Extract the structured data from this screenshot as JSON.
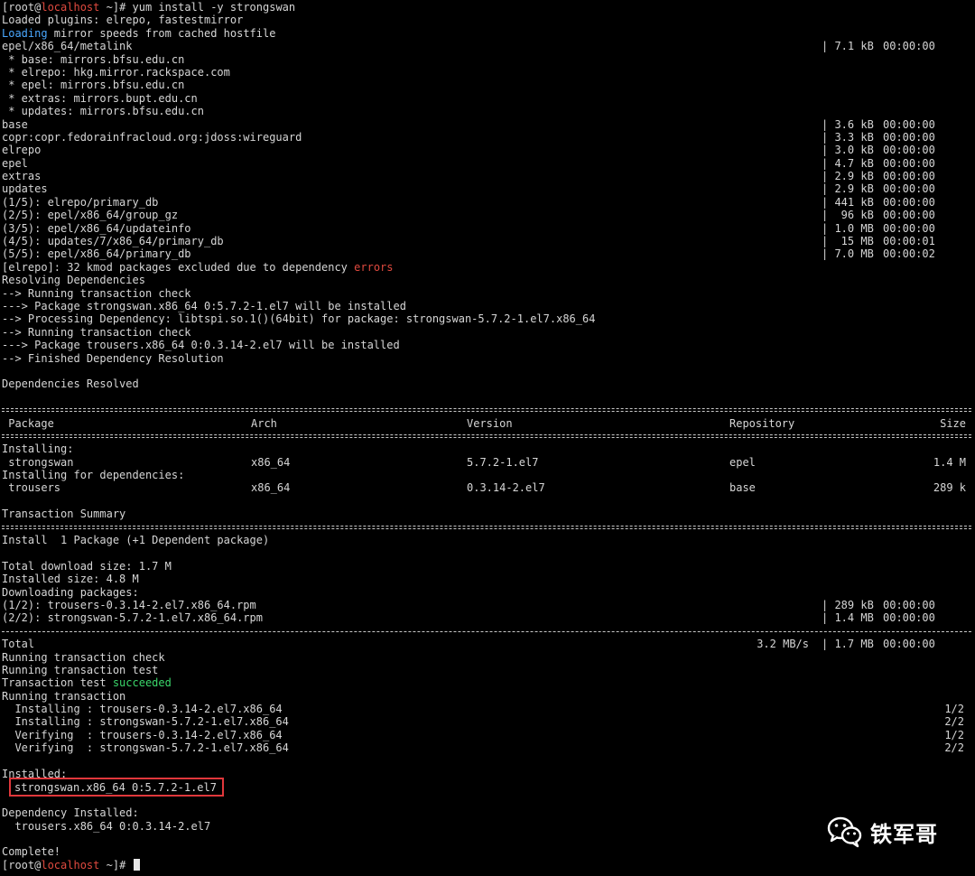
{
  "colors": {
    "background": "#000000",
    "text": "#d6d6d6",
    "hostname": "#e04a3f",
    "info": "#4aa8ff",
    "error": "#e04a3f",
    "success": "#3ad66a",
    "highlight_box": "#e0373b",
    "cursor": "#e8e8e8"
  },
  "prompt": {
    "open": "[root@",
    "host": "localhost",
    "close": " ~]# "
  },
  "command": "yum install -y strongswan",
  "lines": [
    {
      "segments": [
        {
          "text": "Loaded plugins: elrepo, fastestmirror"
        }
      ]
    },
    {
      "segments": [
        {
          "text": "Loading",
          "color": "info"
        },
        {
          "text": " mirror speeds from cached hostfile"
        }
      ]
    },
    {
      "segments": [
        {
          "text": "epel/x86_64/metalink"
        }
      ],
      "size": "| 7.1 kB",
      "meta": "00:00:00"
    },
    {
      "segments": [
        {
          "text": " * base: mirrors.bfsu.edu.cn"
        }
      ]
    },
    {
      "segments": [
        {
          "text": " * elrepo: hkg.mirror.rackspace.com"
        }
      ]
    },
    {
      "segments": [
        {
          "text": " * epel: mirrors.bfsu.edu.cn"
        }
      ]
    },
    {
      "segments": [
        {
          "text": " * extras: mirrors.bupt.edu.cn"
        }
      ]
    },
    {
      "segments": [
        {
          "text": " * updates: mirrors.bfsu.edu.cn"
        }
      ]
    },
    {
      "segments": [
        {
          "text": "base"
        }
      ],
      "size": "| 3.6 kB",
      "meta": "00:00:00"
    },
    {
      "segments": [
        {
          "text": "copr:copr.fedorainfracloud.org:jdoss:wireguard"
        }
      ],
      "size": "| 3.3 kB",
      "meta": "00:00:00"
    },
    {
      "segments": [
        {
          "text": "elrepo"
        }
      ],
      "size": "| 3.0 kB",
      "meta": "00:00:00"
    },
    {
      "segments": [
        {
          "text": "epel"
        }
      ],
      "size": "| 4.7 kB",
      "meta": "00:00:00"
    },
    {
      "segments": [
        {
          "text": "extras"
        }
      ],
      "size": "| 2.9 kB",
      "meta": "00:00:00"
    },
    {
      "segments": [
        {
          "text": "updates"
        }
      ],
      "size": "| 2.9 kB",
      "meta": "00:00:00"
    },
    {
      "segments": [
        {
          "text": "(1/5): elrepo/primary_db"
        }
      ],
      "size": "| 441 kB",
      "meta": "00:00:00"
    },
    {
      "segments": [
        {
          "text": "(2/5): epel/x86_64/group_gz"
        }
      ],
      "size": "|  96 kB",
      "meta": "00:00:00"
    },
    {
      "segments": [
        {
          "text": "(3/5): epel/x86_64/updateinfo"
        }
      ],
      "size": "| 1.0 MB",
      "meta": "00:00:00"
    },
    {
      "segments": [
        {
          "text": "(4/5): updates/7/x86_64/primary_db"
        }
      ],
      "size": "|  15 MB",
      "meta": "00:00:01"
    },
    {
      "segments": [
        {
          "text": "(5/5): epel/x86_64/primary_db"
        }
      ],
      "size": "| 7.0 MB",
      "meta": "00:00:02"
    },
    {
      "segments": [
        {
          "text": "[elrepo]: 32 kmod packages excluded due to dependency "
        },
        {
          "text": "errors",
          "color": "error"
        }
      ]
    },
    {
      "segments": [
        {
          "text": "Resolving Dependencies"
        }
      ]
    },
    {
      "segments": [
        {
          "text": "--> Running transaction check"
        }
      ]
    },
    {
      "segments": [
        {
          "text": "---> Package strongswan.x86_64 0:5.7.2-1.el7 will be installed"
        }
      ]
    },
    {
      "segments": [
        {
          "text": "--> Processing Dependency: libtspi.so.1()(64bit) for package: strongswan-5.7.2-1.el7.x86_64"
        }
      ]
    },
    {
      "segments": [
        {
          "text": "--> Running transaction check"
        }
      ]
    },
    {
      "segments": [
        {
          "text": "---> Package trousers.x86_64 0:0.3.14-2.el7 will be installed"
        }
      ]
    },
    {
      "segments": [
        {
          "text": "--> Finished Dependency Resolution"
        }
      ]
    },
    {
      "segments": []
    },
    {
      "segments": [
        {
          "text": "Dependencies Resolved"
        }
      ]
    },
    {
      "segments": []
    },
    {
      "sep": "double"
    },
    {
      "cols": [
        " Package",
        "Arch",
        "Version",
        "Repository",
        "Size"
      ]
    },
    {
      "sep": "double"
    },
    {
      "segments": [
        {
          "text": "Installing:"
        }
      ]
    },
    {
      "cols": [
        " strongswan",
        "x86_64",
        "5.7.2-1.el7",
        "epel",
        "1.4 M"
      ]
    },
    {
      "segments": [
        {
          "text": "Installing for dependencies:"
        }
      ]
    },
    {
      "cols": [
        " trousers",
        "x86_64",
        "0.3.14-2.el7",
        "base",
        "289 k"
      ]
    },
    {
      "segments": []
    },
    {
      "segments": [
        {
          "text": "Transaction Summary"
        }
      ]
    },
    {
      "sep": "double"
    },
    {
      "segments": [
        {
          "text": "Install  1 Package (+1 Dependent package)"
        }
      ]
    },
    {
      "segments": []
    },
    {
      "segments": [
        {
          "text": "Total download size: 1.7 M"
        }
      ]
    },
    {
      "segments": [
        {
          "text": "Installed size: 4.8 M"
        }
      ]
    },
    {
      "segments": [
        {
          "text": "Downloading packages:"
        }
      ]
    },
    {
      "segments": [
        {
          "text": "(1/2): trousers-0.3.14-2.el7.x86_64.rpm"
        }
      ],
      "size": "| 289 kB",
      "meta": "00:00:00"
    },
    {
      "segments": [
        {
          "text": "(2/2): strongswan-5.7.2-1.el7.x86_64.rpm"
        }
      ],
      "size": "| 1.4 MB",
      "meta": "00:00:00"
    },
    {
      "sep": "single"
    },
    {
      "segments": [
        {
          "text": "Total"
        }
      ],
      "rate": "3.2 MB/s",
      "size": "| 1.7 MB",
      "meta": "00:00:00"
    },
    {
      "segments": [
        {
          "text": "Running transaction check"
        }
      ]
    },
    {
      "segments": [
        {
          "text": "Running transaction test"
        }
      ]
    },
    {
      "segments": [
        {
          "text": "Transaction test "
        },
        {
          "text": "succeeded",
          "color": "success"
        }
      ]
    },
    {
      "segments": [
        {
          "text": "Running transaction"
        }
      ]
    },
    {
      "segments": [
        {
          "text": "  Installing : trousers-0.3.14-2.el7.x86_64"
        }
      ],
      "count": "1/2"
    },
    {
      "segments": [
        {
          "text": "  Installing : strongswan-5.7.2-1.el7.x86_64"
        }
      ],
      "count": "2/2"
    },
    {
      "segments": [
        {
          "text": "  Verifying  : trousers-0.3.14-2.el7.x86_64"
        }
      ],
      "count": "1/2"
    },
    {
      "segments": [
        {
          "text": "  Verifying  : strongswan-5.7.2-1.el7.x86_64"
        }
      ],
      "count": "2/2"
    },
    {
      "segments": []
    },
    {
      "segments": [
        {
          "text": "Installed:"
        }
      ]
    },
    {
      "boxed": "strongswan.x86_64 0:5.7.2-1.el7"
    },
    {
      "segments": []
    },
    {
      "segments": [
        {
          "text": "Dependency Installed:"
        }
      ]
    },
    {
      "segments": [
        {
          "text": "  trousers.x86_64 0:0.3.14-2.el7"
        }
      ]
    },
    {
      "segments": []
    },
    {
      "segments": [
        {
          "text": "Complete!"
        }
      ]
    }
  ],
  "watermark": {
    "icon": "wechat-icon",
    "text": "铁军哥"
  }
}
